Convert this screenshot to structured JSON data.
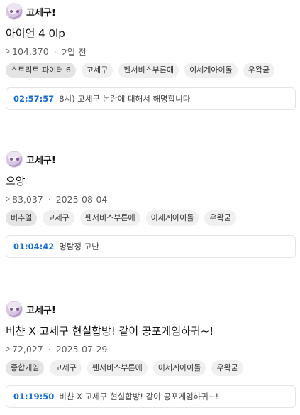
{
  "videos": [
    {
      "channel": "고세구!",
      "title": "아이언 4 0lp",
      "views": "104,370",
      "date": "2일 전",
      "tags": [
        "스트리트 파이터 6",
        "고세구",
        "펜서비스부른애",
        "이세계아이돌",
        "우왁굳"
      ],
      "chapter": {
        "time": "02:57:57",
        "title": "8시) 고세구 논란에 대해서 해명합니다"
      }
    },
    {
      "channel": "고세구!",
      "title": "으앙",
      "views": "83,037",
      "date": "2025-08-04",
      "tags": [
        "버추얼",
        "고세구",
        "펜서비스부른애",
        "이세계아이돌",
        "우왁굳"
      ],
      "chapter": {
        "time": "01:04:42",
        "title": "명탐정 고난"
      }
    },
    {
      "channel": "고세구!",
      "title": "비챤 X 고세구 현실합방! 같이 공포게임하귀~!",
      "views": "72,027",
      "date": "2025-07-29",
      "tags": [
        "종합게임",
        "고세구",
        "펜서비스부른애",
        "이세계아이돌",
        "우왁굳"
      ],
      "chapter": {
        "time": "01:19:50",
        "title": "비챤 X 고세구 현실합방! 같이 공포게임하귀~!"
      }
    }
  ],
  "icons": {
    "avatar": "channel-avatar",
    "views": "play-icon"
  },
  "colors": {
    "chapter_time": "#1b6fd0",
    "tag_bg": "#f0f0f0"
  }
}
